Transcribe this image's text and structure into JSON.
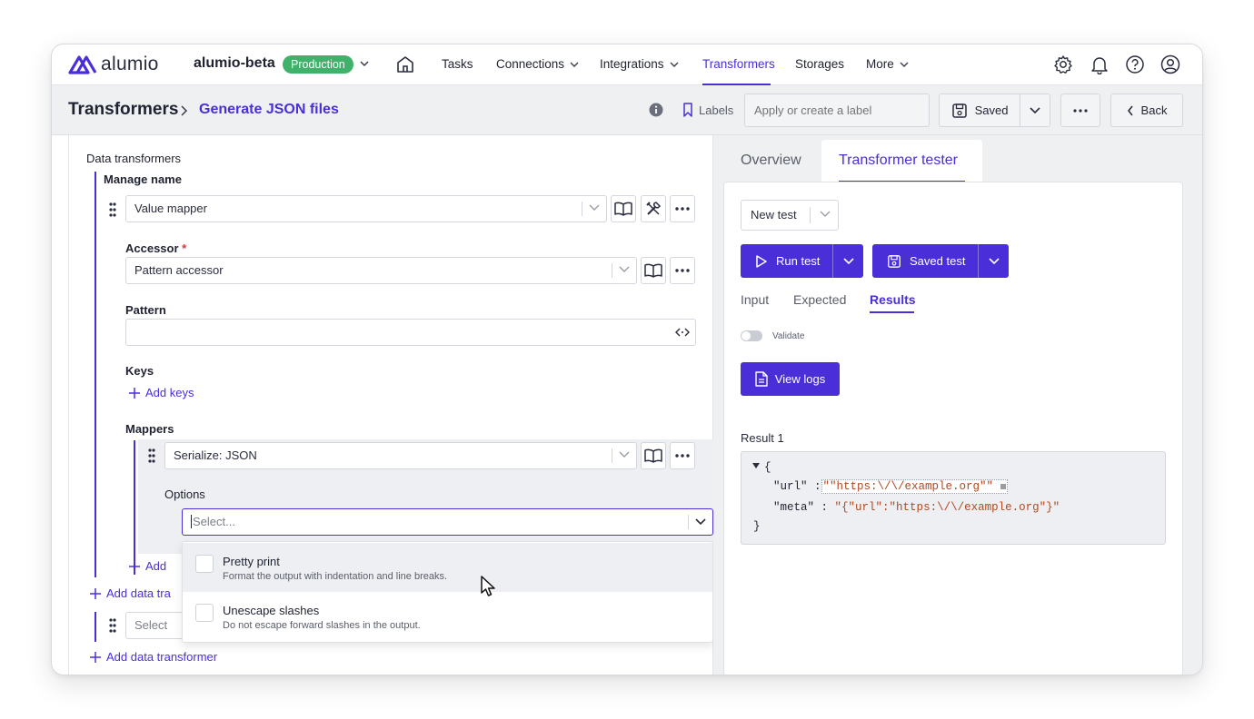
{
  "brand": {
    "name": "alumio",
    "accent": "#4a2fd8"
  },
  "environment": {
    "name": "alumio-beta",
    "badge": "Production",
    "badge_color": "#3fb16b"
  },
  "nav": {
    "items": [
      {
        "label": "Tasks"
      },
      {
        "label": "Connections"
      },
      {
        "label": "Integrations"
      },
      {
        "label": "Transformers"
      },
      {
        "label": "Storages"
      },
      {
        "label": "More"
      }
    ],
    "active": "Transformers",
    "icons": [
      "home-icon",
      "settings-icon",
      "bell-icon",
      "help-icon",
      "user-icon"
    ]
  },
  "breadcrumb": {
    "root": "Transformers",
    "current": "Generate JSON files"
  },
  "toolbar": {
    "labels_text": "Labels",
    "label_placeholder": "Apply or create a label",
    "saved_label": "Saved",
    "back_label": "Back"
  },
  "editor": {
    "section_title": "Data transformers",
    "group_title": "Manage name",
    "transformer_select": "Value mapper",
    "accessor_label": "Accessor",
    "accessor_required": "*",
    "accessor_value": "Pattern accessor",
    "pattern_label": "Pattern",
    "pattern_value": "",
    "keys_label": "Keys",
    "add_keys": "Add keys",
    "mappers_label": "Mappers",
    "mapper_value": "Serialize: JSON",
    "options_label": "Options",
    "options_placeholder": "Select...",
    "add_mapper_partial": "Add",
    "add_data_transformer_partial": "Add data tra",
    "select_partial": "Select",
    "add_data_transformer": "Add data transformer",
    "options_dropdown": [
      {
        "title": "Pretty print",
        "description": "Format the output with indentation and line breaks.",
        "checked": false
      },
      {
        "title": "Unescape slashes",
        "description": "Do not escape forward slashes in the output.",
        "checked": false
      }
    ]
  },
  "tester": {
    "tabs": [
      "Overview",
      "Transformer tester"
    ],
    "active_tab": "Transformer tester",
    "new_test_select": "New test",
    "run_test": "Run test",
    "saved_test": "Saved test",
    "subtabs": [
      "Input",
      "Expected",
      "Results"
    ],
    "active_subtab": "Results",
    "validate_label": "Validate",
    "validate_on": false,
    "view_logs": "View logs",
    "result_title": "Result 1",
    "result_json": {
      "open": "{",
      "close": "}",
      "lines": [
        {
          "key": "\"url\"",
          "sep": " :",
          "value": "\"\"https:\\/\\/example.org\"\""
        },
        {
          "key": "\"meta\"",
          "sep": " :",
          "value": "\"{\"url\":\"https:\\/\\/example.org\"}\""
        }
      ]
    }
  }
}
